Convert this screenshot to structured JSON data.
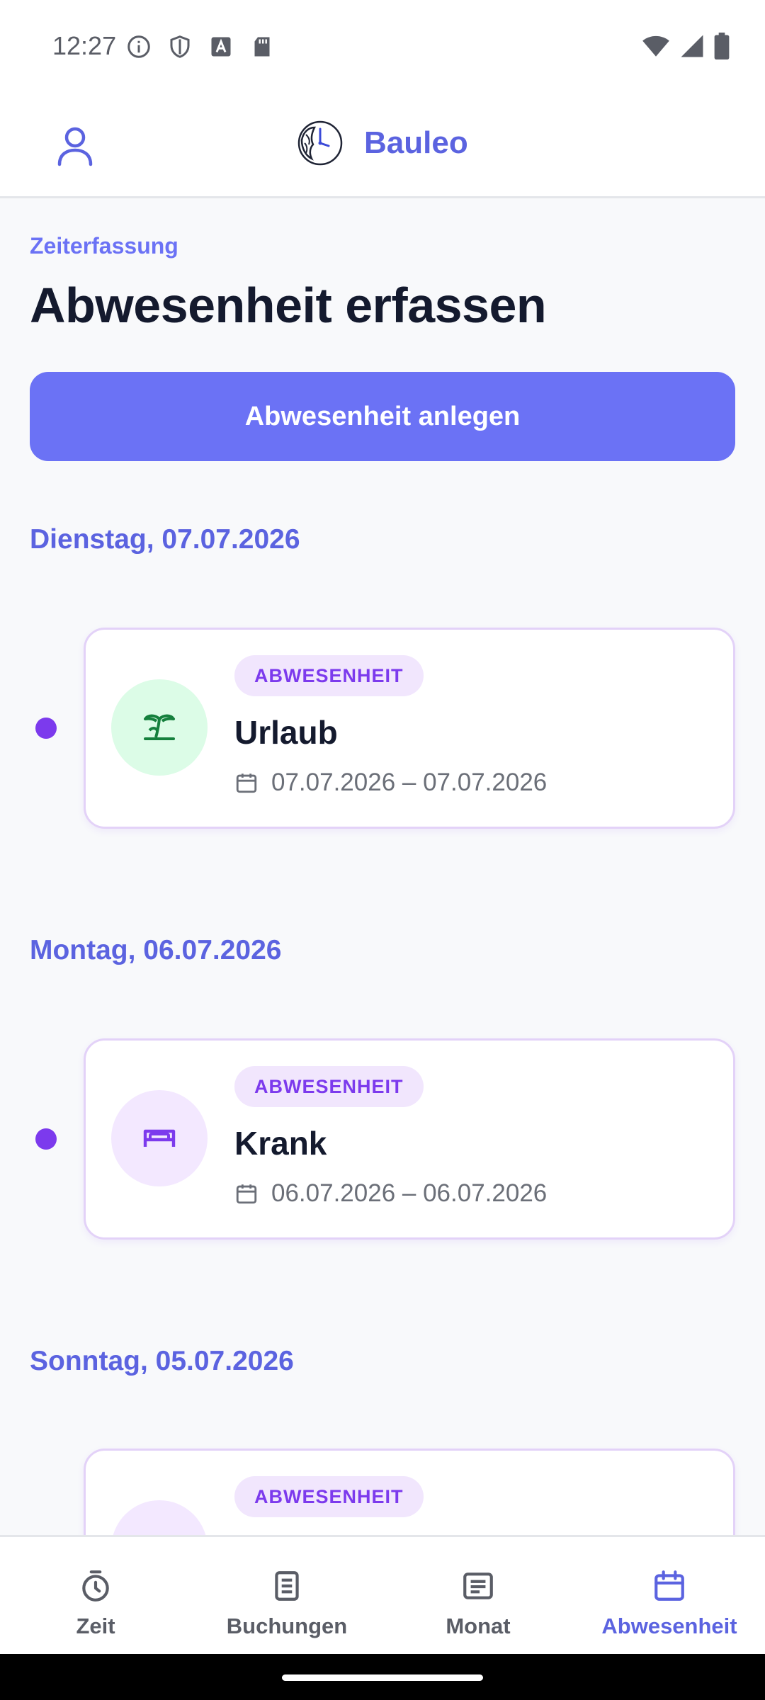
{
  "status_bar": {
    "time": "12:27"
  },
  "app_bar": {
    "brand_name": "Bauleo"
  },
  "page": {
    "overline": "Zeiterfassung",
    "title": "Abwesenheit erfassen",
    "primary_button": "Abwesenheit anlegen"
  },
  "groups": [
    {
      "date_heading": "Dienstag, 07.07.2026",
      "entry": {
        "badge": "ABWESENHEIT",
        "title": "Urlaub",
        "range": "07.07.2026 – 07.07.2026",
        "icon": "palm-tree-icon",
        "icon_bg": "#dcfce7",
        "icon_color": "#15803d"
      }
    },
    {
      "date_heading": "Montag, 06.07.2026",
      "entry": {
        "badge": "ABWESENHEIT",
        "title": "Krank",
        "range": "06.07.2026 – 06.07.2026",
        "icon": "bed-icon",
        "icon_bg": "#f3e8ff",
        "icon_color": "#7c3aed"
      }
    },
    {
      "date_heading": "Sonntag, 05.07.2026",
      "entry": {
        "badge": "ABWESENHEIT",
        "icon_bg": "#f3e8ff"
      }
    }
  ],
  "bottom_nav": {
    "items": [
      {
        "label": "Zeit",
        "icon": "stopwatch-icon",
        "active": false
      },
      {
        "label": "Buchungen",
        "icon": "document-icon",
        "active": false
      },
      {
        "label": "Monat",
        "icon": "list-icon",
        "active": false
      },
      {
        "label": "Abwesenheit",
        "icon": "calendar-icon",
        "active": true
      }
    ]
  },
  "colors": {
    "primary": "#6b72f5",
    "accent_text": "#5b63e0",
    "dot": "#7c3aed"
  }
}
